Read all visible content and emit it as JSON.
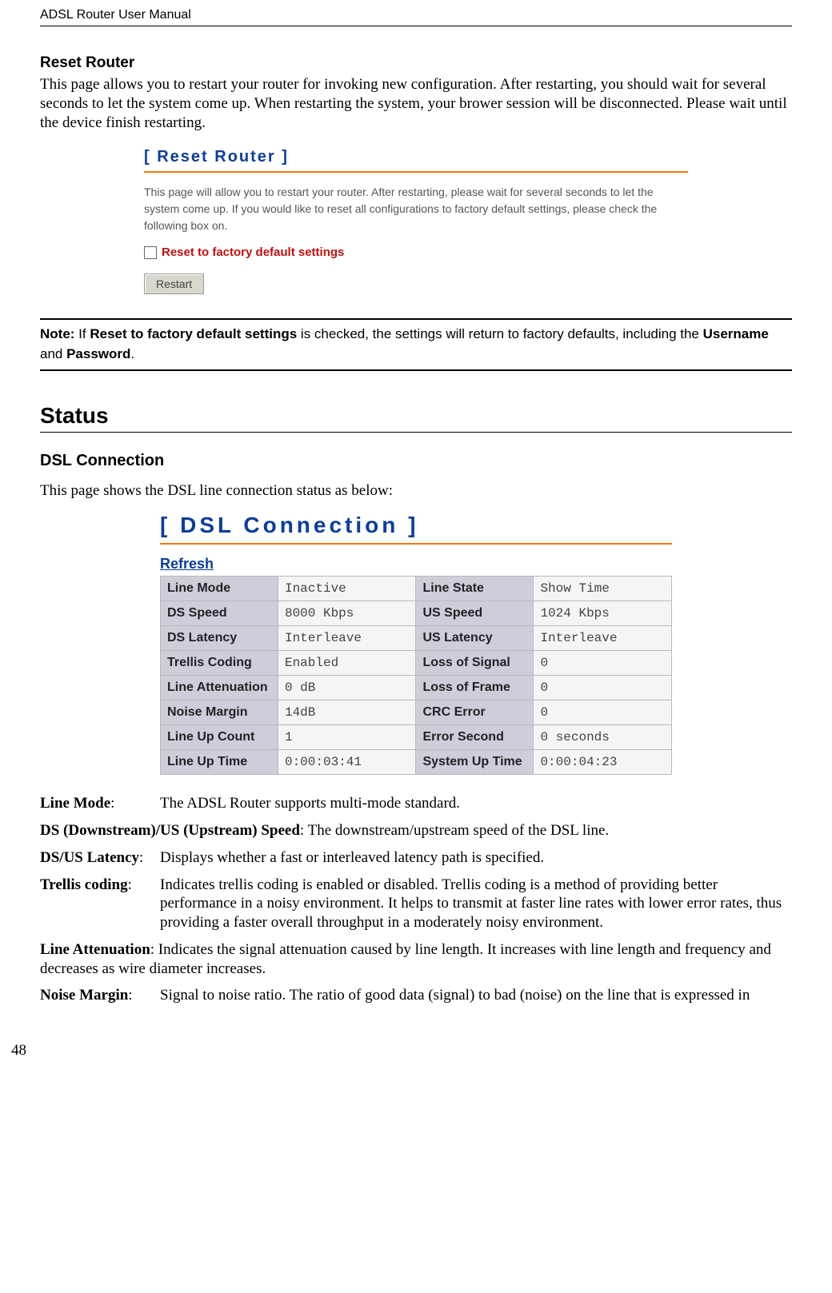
{
  "header": "ADSL Router User Manual",
  "reset": {
    "title": "Reset Router",
    "intro": "This page allows you to restart your router for invoking new configuration. After restarting, you should wait for several seconds to let the system come up. When restarting the system, your brower session will be disconnected. Please wait until the device finish restarting.",
    "panel_title": "[ Reset Router ]",
    "panel_desc": "This page will allow you to restart your router. After restarting, please wait for several seconds to let the system come up. If you would like to reset all configurations to factory default settings, please check the following box on.",
    "checkbox_label": "Reset to factory default settings",
    "button": "Restart"
  },
  "note": {
    "prefix": "Note:",
    "body1": " If ",
    "bold1": "Reset to factory default settings",
    "body2": " is checked, the settings will return to factory defaults, including the ",
    "bold2": "Username",
    "body3": " and ",
    "bold3": "Password",
    "body4": "."
  },
  "status": {
    "heading": "Status",
    "sub": "DSL Connection",
    "intro": "This page shows the DSL line connection status as below:",
    "panel_title": "[ DSL Connection ]",
    "refresh": "Refresh",
    "rows": [
      {
        "l1": "Line Mode",
        "v1": "Inactive",
        "l2": "Line State",
        "v2": "Show Time"
      },
      {
        "l1": "DS Speed",
        "v1": "8000 Kbps",
        "l2": "US Speed",
        "v2": "1024 Kbps"
      },
      {
        "l1": "DS Latency",
        "v1": "Interleave",
        "l2": "US Latency",
        "v2": "Interleave"
      },
      {
        "l1": "Trellis Coding",
        "v1": "Enabled",
        "l2": "Loss of Signal",
        "v2": "0"
      },
      {
        "l1": "Line Attenuation",
        "v1": "0 dB",
        "l2": "Loss of Frame",
        "v2": "0"
      },
      {
        "l1": "Noise Margin",
        "v1": "14dB",
        "l2": "CRC Error",
        "v2": "0"
      },
      {
        "l1": "Line Up Count",
        "v1": "1",
        "l2": "Error Second",
        "v2": "0 seconds"
      },
      {
        "l1": "Line Up Time",
        "v1": "0:00:03:41",
        "l2": "System Up Time",
        "v2": "0:00:04:23"
      }
    ]
  },
  "defs": {
    "line_mode_term": "Line Mode",
    "line_mode_def": "The ADSL Router supports multi-mode standard.",
    "ds_us_speed_full": "DS (Downstream)/US (Upstream) Speed",
    "ds_us_speed_def": ": The downstream/upstream speed of the DSL line.",
    "latency_term": "DS/US Latency",
    "latency_def": "Displays whether a fast or interleaved latency path is specified.",
    "trellis_term": "Trellis coding",
    "trellis_def": "Indicates trellis coding is enabled or disabled. Trellis coding is a method of providing better performance in a noisy environment. It helps to transmit at faster line rates with lower error rates, thus providing a faster overall throughput in a moderately noisy environment.",
    "atten_term": "Line Attenuation",
    "atten_def": ": Indicates the signal attenuation caused by line length. It increases with line length and frequency and decreases as wire diameter increases.",
    "noise_term": "Noise Margin",
    "noise_def": "Signal to noise ratio. The ratio of good data (signal) to bad (noise) on the line that is expressed in"
  },
  "page_number": "48"
}
